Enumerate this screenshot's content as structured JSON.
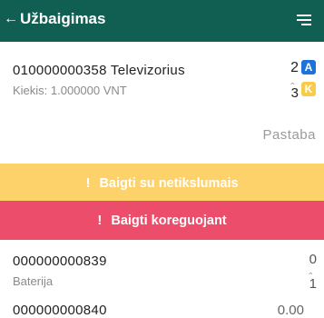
{
  "header": {
    "back_arrow": "←",
    "title": "Užbaigimas"
  },
  "items": [
    {
      "code_name": "010000000358 Televizorius",
      "quantity_label": "Kiekis: 1.000000 VNT",
      "count_top": "2",
      "count_bottom": "3",
      "badge_top": "A",
      "badge_bottom": "K"
    },
    {
      "code": "000000000839",
      "name": "Baterija",
      "count_top": "0",
      "count_bottom": "1"
    },
    {
      "code": "000000000840",
      "amount": "0.00"
    }
  ],
  "note_label": "Pastaba",
  "buttons": {
    "finish_with_errors": "Baigti su netikslumais",
    "finish_correcting": "Baigti koreguojant",
    "exclamation": "!"
  },
  "colors": {
    "header_bg": "#115f52",
    "yellow_button": "#fdd26b",
    "red_button": "#ec4d6a",
    "badge_blue": "#1e73d8",
    "badge_yellow": "#f7cc4a"
  }
}
